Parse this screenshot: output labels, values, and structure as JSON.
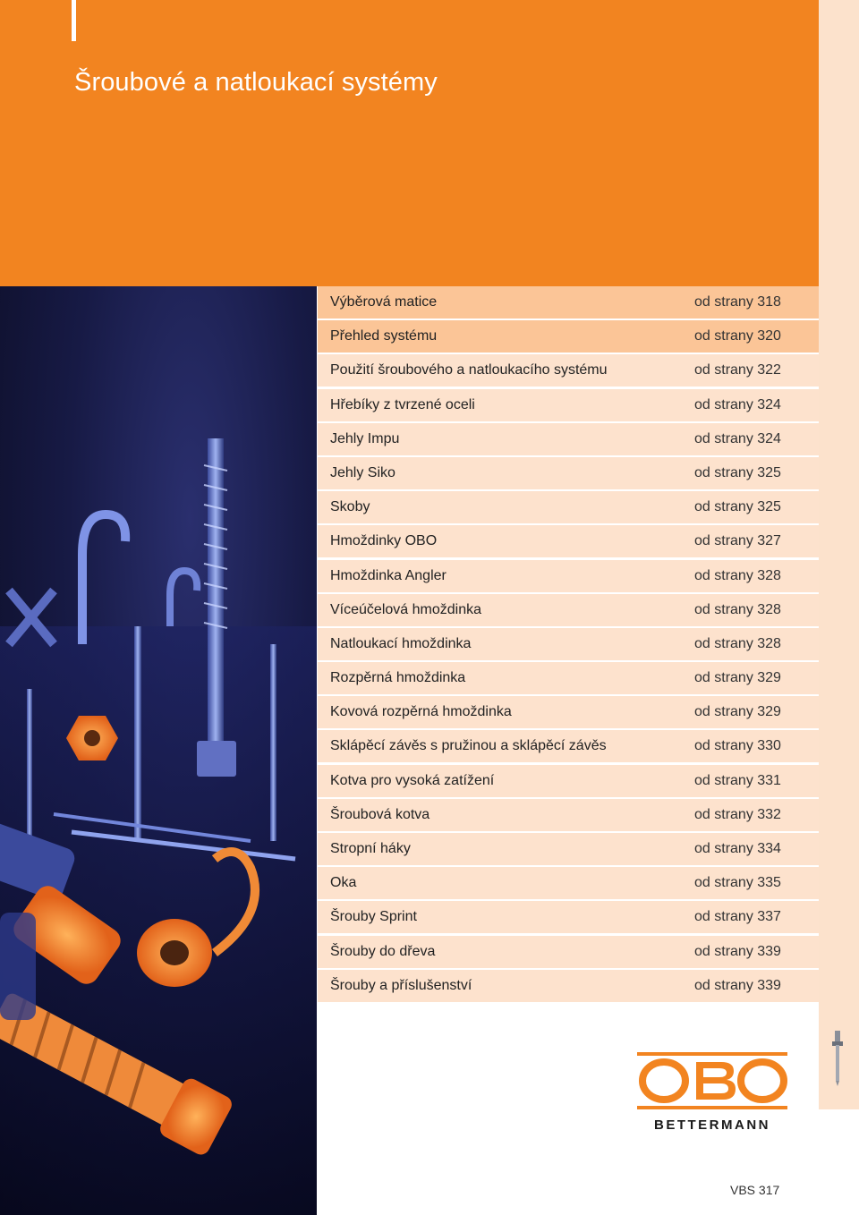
{
  "header": {
    "title": "Šroubové a natloukací systémy"
  },
  "toc": [
    {
      "title": "Výběrová matice",
      "page": "od strany  318"
    },
    {
      "title": "Přehled systému",
      "page": "od strany  320"
    },
    {
      "title": "Použití šroubového a natloukacího systému",
      "page": "od strany  322"
    },
    {
      "title": "Hřebíky z tvrzené oceli",
      "page": "od strany  324"
    },
    {
      "title": "Jehly Impu",
      "page": "od strany  324"
    },
    {
      "title": "Jehly Siko",
      "page": "od strany  325"
    },
    {
      "title": "Skoby",
      "page": "od strany  325"
    },
    {
      "title": "Hmoždinky OBO",
      "page": "od strany  327"
    },
    {
      "title": "Hmoždinka Angler",
      "page": "od strany  328"
    },
    {
      "title": "Víceúčelová hmoždinka",
      "page": "od strany  328"
    },
    {
      "title": "Natloukací hmoždinka",
      "page": "od strany  328"
    },
    {
      "title": "Rozpěrná hmoždinka",
      "page": "od strany  329"
    },
    {
      "title": "Kovová rozpěrná hmoždinka",
      "page": "od strany 329"
    },
    {
      "title": "Sklápěcí závěs s pružinou a sklápěcí závěs",
      "page": "od strany  330"
    },
    {
      "title": "Kotva pro vysoká zatížení",
      "page": "od strany  331"
    },
    {
      "title": "Šroubová kotva",
      "page": "od strany  332"
    },
    {
      "title": "Stropní háky",
      "page": "od strany  334"
    },
    {
      "title": "Oka",
      "page": "od strany  335"
    },
    {
      "title": "Šrouby Sprint",
      "page": "od strany  337"
    },
    {
      "title": "Šrouby do dřeva",
      "page": "od strany  339"
    },
    {
      "title": "Šrouby a příslušenství",
      "page": "od strany  339"
    }
  ],
  "logo": {
    "letters": "OBO",
    "wordmark": "BETTERMANN"
  },
  "footer": {
    "code": "VBS  317"
  },
  "colors": {
    "brand_orange": "#f28420",
    "row_light": "#fde2cd",
    "row_highlight": "#fbc597"
  }
}
